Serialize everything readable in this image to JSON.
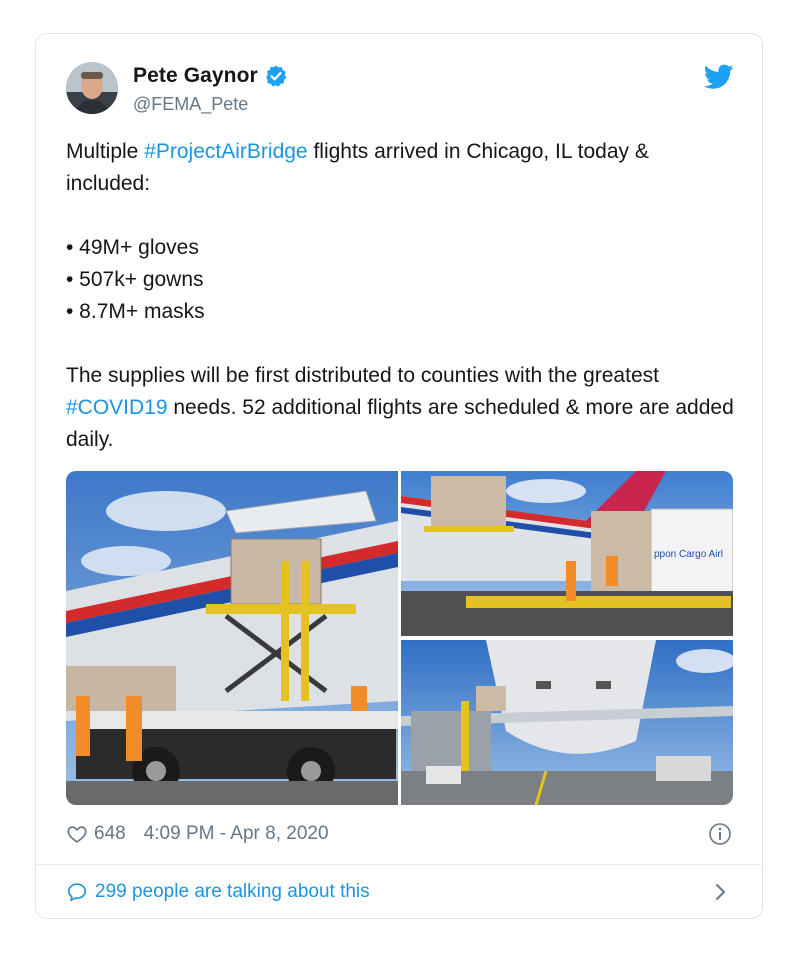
{
  "author": {
    "name": "Pete Gaynor",
    "handle": "@FEMA_Pete",
    "verified": true
  },
  "tweet": {
    "line1_pre": "Multiple ",
    "hashtag1": "#ProjectAirBridge",
    "line1_post": " flights arrived in Chicago, IL today & included:",
    "bullets": [
      "• 49M+ gloves",
      "• 507k+ gowns",
      "• 8.7M+ masks"
    ],
    "para2_pre": "The supplies will be first distributed to counties with the greatest ",
    "hashtag2": "#COVID19",
    "para2_post": " needs. 52 additional flights are scheduled & more are added daily."
  },
  "media": {
    "images": [
      "cargo-loading-photo-left",
      "cargo-loading-photo-top-right",
      "aircraft-underside-photo-bottom-right"
    ],
    "fuselage_text": "ppon Cargo Airl"
  },
  "meta": {
    "likes": "648",
    "timestamp": "4:09 PM - Apr 8, 2020"
  },
  "footer": {
    "conversation": "299 people are talking about this"
  },
  "colors": {
    "link": "#1b95e0",
    "secondary_text": "#657786",
    "twitter_blue": "#1da1f2"
  }
}
